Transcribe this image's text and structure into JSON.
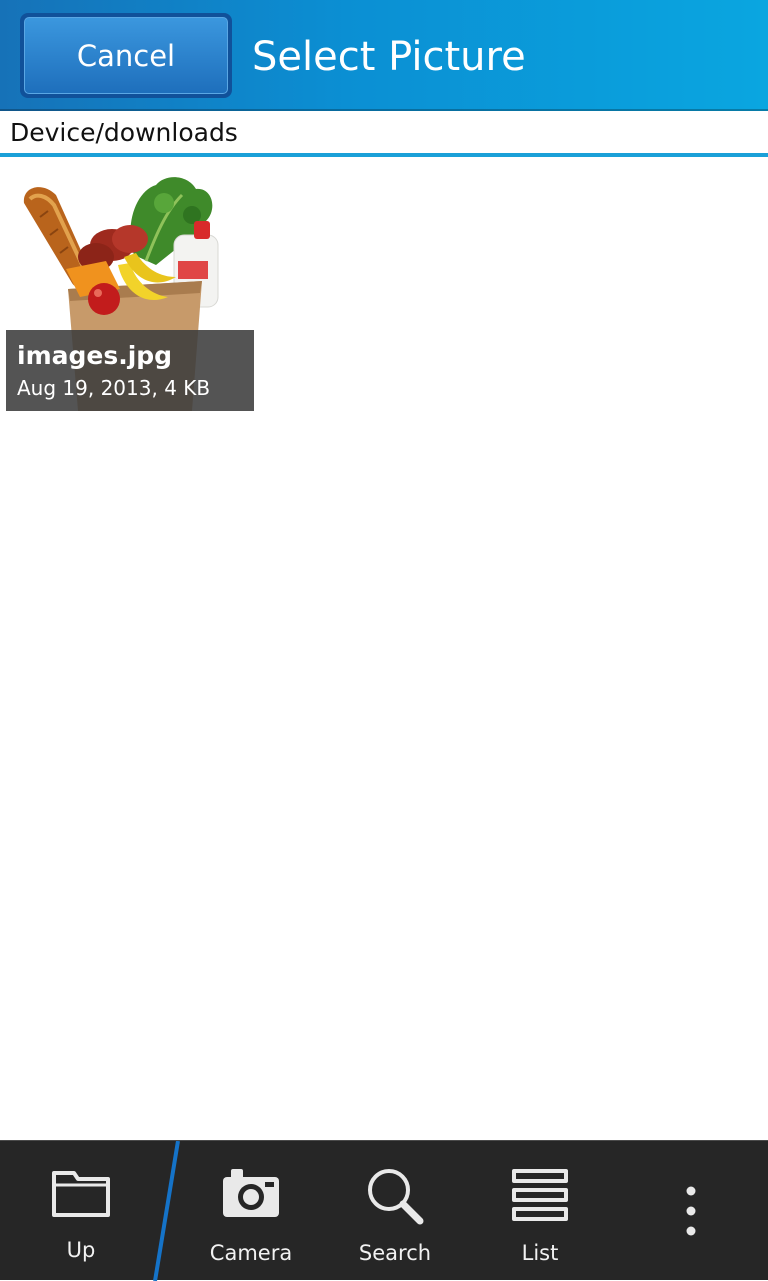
{
  "titlebar": {
    "cancel_label": "Cancel",
    "title": "Select Picture",
    "accent": "#0b8fd3"
  },
  "breadcrumb": {
    "path": "Device/downloads"
  },
  "files": [
    {
      "name": "images.jpg",
      "meta": "Aug 19, 2013, 4 KB",
      "thumbnail": "grocery-bag-image"
    }
  ],
  "actionbar": {
    "up_label": "Up",
    "camera_label": "Camera",
    "search_label": "Search",
    "list_label": "List",
    "more_icon": "vertical-dots-icon"
  }
}
